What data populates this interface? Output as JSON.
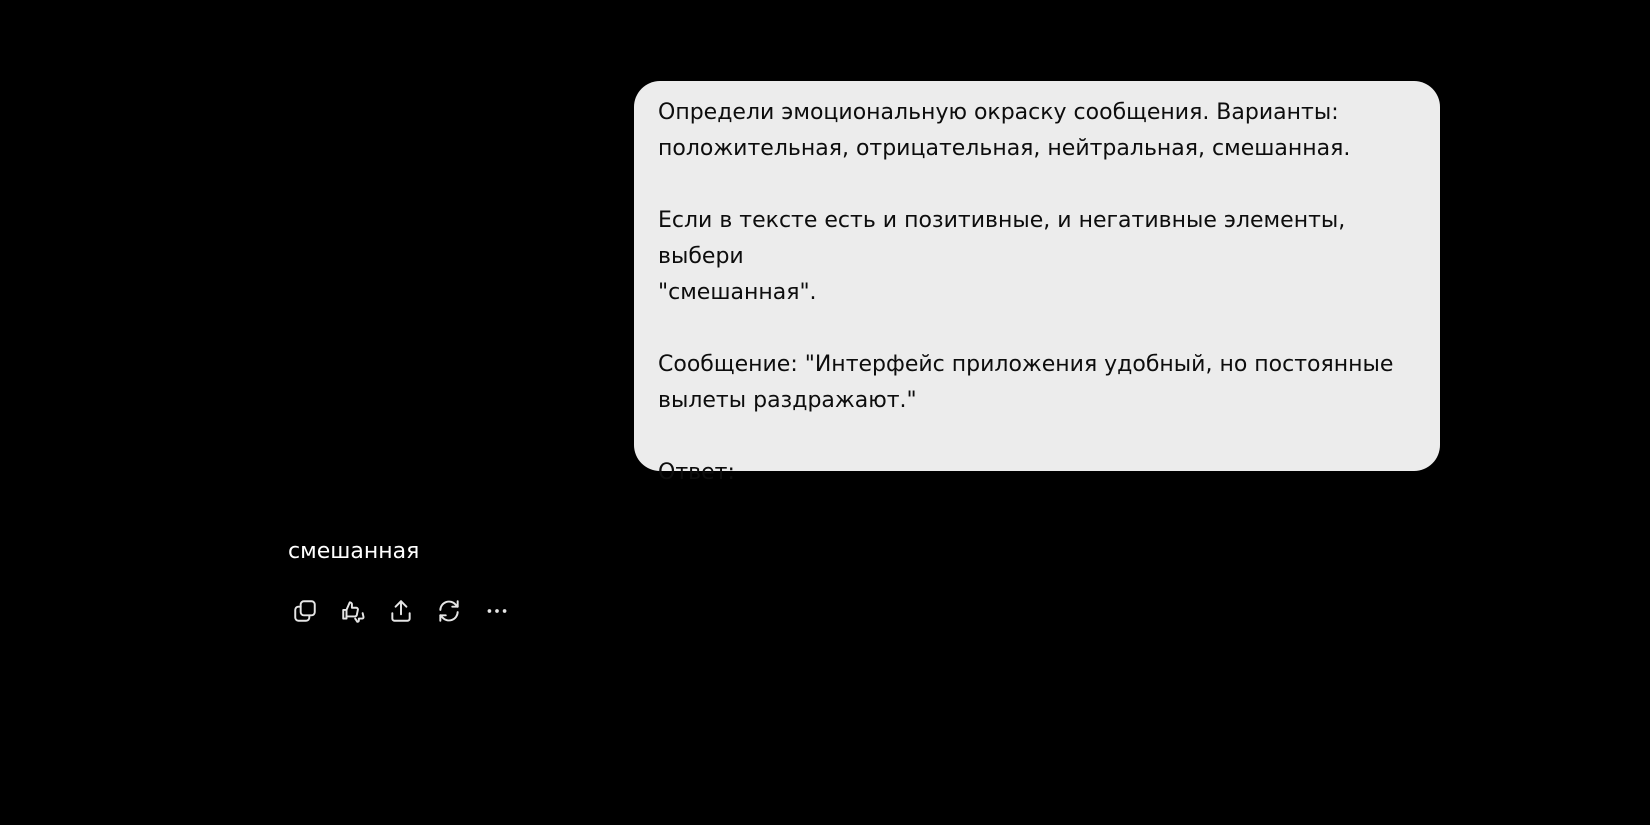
{
  "user_message": {
    "line1": "Определи эмоциональную окраску сообщения. Варианты:",
    "line2": "положительная, отрицательная, нейтральная, смешанная.",
    "line3": "Если в тексте есть и позитивные, и негативные элементы, выбери",
    "line4": "\"смешанная\".",
    "line5": "Сообщение: \"Интерфейс приложения удобный, но постоянные",
    "line6": "вылеты раздражают.\"",
    "line7": "Ответ:"
  },
  "assistant_message": {
    "text": "смешанная"
  },
  "actions": [
    {
      "icon": "copy-icon"
    },
    {
      "icon": "thumbs-up-down-icon"
    },
    {
      "icon": "share-icon"
    },
    {
      "icon": "regenerate-icon"
    },
    {
      "icon": "more-icon"
    }
  ],
  "colors": {
    "background": "#000000",
    "user_bubble": "#ececec",
    "user_text": "#0d0d0d",
    "assistant_text": "#ffffff",
    "icon": "#e6e6e6"
  }
}
